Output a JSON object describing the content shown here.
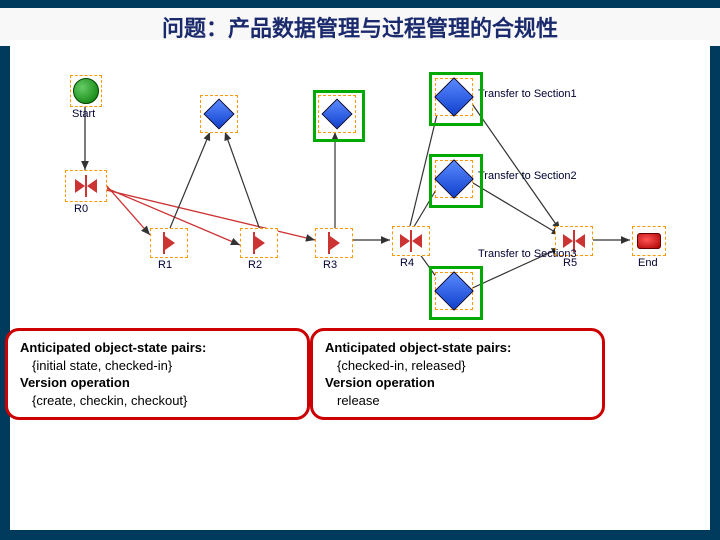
{
  "title": "问题：产品数据管理与过程管理的合规性",
  "nodes": {
    "start": "Start",
    "end": "End",
    "r0": "R0",
    "r1": "R1",
    "r2": "R2",
    "r3": "R3",
    "r4": "R4",
    "r5": "R5",
    "t1": "Transfer to Section1",
    "t2": "Transfer to Section2",
    "t3": "Transfer to Section3"
  },
  "callout_left": {
    "h1": "Anticipated object-state pairs:",
    "l1": "{initial state, checked-in}",
    "h2": "Version operation",
    "l2": "{create, checkin, checkout}"
  },
  "callout_right": {
    "h1": "Anticipated object-state pairs:",
    "l1": "{checked-in, released}",
    "h2": "Version operation",
    "l2": "release"
  }
}
